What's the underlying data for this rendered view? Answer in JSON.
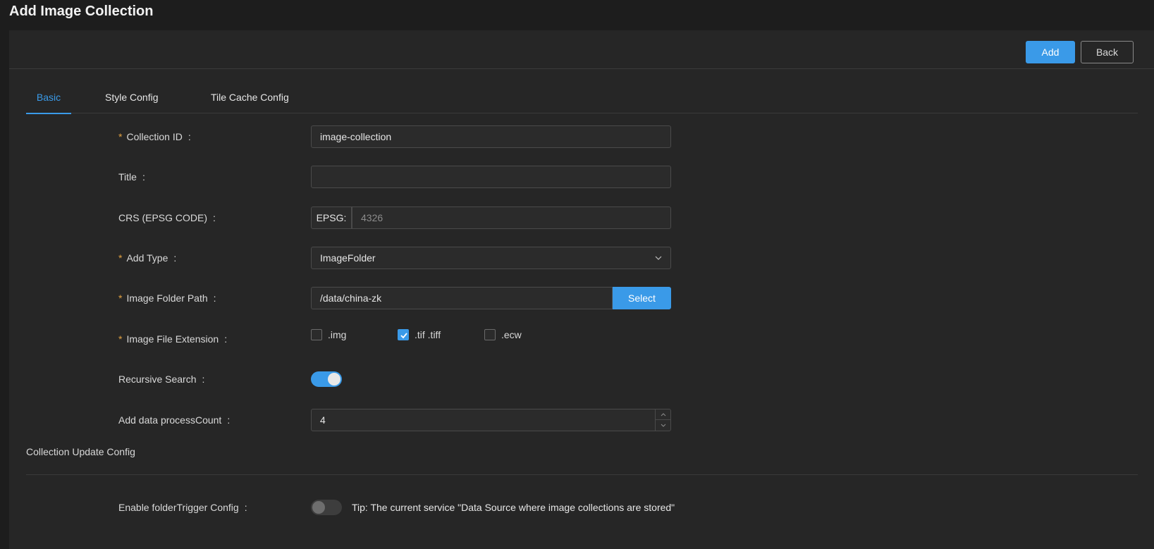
{
  "page": {
    "title": "Add Image Collection"
  },
  "toolbar": {
    "add_label": "Add",
    "back_label": "Back"
  },
  "tabs": [
    {
      "label": "Basic",
      "active": true
    },
    {
      "label": "Style Config",
      "active": false
    },
    {
      "label": "Tile Cache Config",
      "active": false
    }
  ],
  "form": {
    "collection_id": {
      "label": "Collection ID",
      "required": "*",
      "colon": ":",
      "value": "image-collection"
    },
    "title": {
      "label": "Title",
      "colon": ":",
      "value": ""
    },
    "crs": {
      "label": "CRS (EPSG CODE)",
      "colon": ":",
      "addon": "EPSG:",
      "placeholder": "4326"
    },
    "add_type": {
      "label": "Add Type",
      "required": "*",
      "colon": ":",
      "value": "ImageFolder"
    },
    "folder_path": {
      "label": "Image Folder Path",
      "required": "*",
      "colon": ":",
      "value": "/data/china-zk",
      "select_label": "Select"
    },
    "file_extension": {
      "label": "Image File Extension",
      "required": "*",
      "colon": ":",
      "options": [
        {
          "label": ".img",
          "checked": false
        },
        {
          "label": ".tif .tiff",
          "checked": true
        },
        {
          "label": ".ecw",
          "checked": false
        }
      ]
    },
    "recursive_search": {
      "label": "Recursive Search",
      "colon": ":",
      "enabled": true
    },
    "process_count": {
      "label": "Add data processCount",
      "colon": ":",
      "value": "4"
    }
  },
  "update_config": {
    "section_title": "Collection Update Config",
    "folder_trigger": {
      "label": "Enable folderTrigger Config",
      "colon": ":",
      "enabled": false,
      "tip": "Tip: The current service \"Data Source where image collections are stored\""
    }
  },
  "colors": {
    "accent": "#3a9ae8",
    "background": "#1d1d1d",
    "panel": "#262626",
    "required": "#e0a040"
  }
}
